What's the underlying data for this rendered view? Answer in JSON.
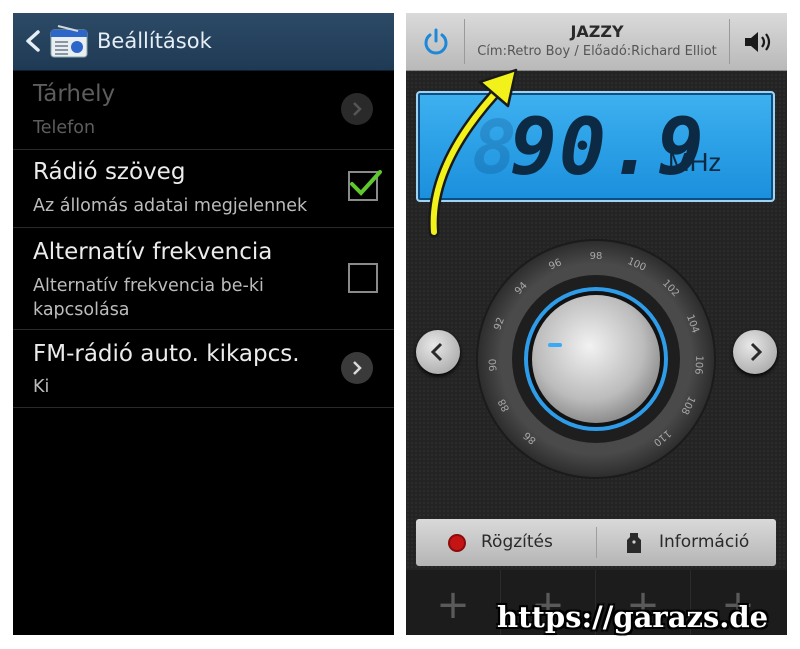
{
  "settings_screen": {
    "title": "Beállítások",
    "items": [
      {
        "title": "Tárhely",
        "subtitle": "Telefon",
        "control": "chevron",
        "enabled": false
      },
      {
        "title": "Rádió szöveg",
        "subtitle": "Az állomás adatai megjelennek",
        "control": "checkbox",
        "checked": true
      },
      {
        "title": "Alternatív frekvencia",
        "subtitle": "Alternatív frekvencia be-ki kapcsolása",
        "control": "checkbox",
        "checked": false
      },
      {
        "title": "FM-rádió auto. kikapcs.",
        "subtitle": "Ki",
        "control": "chevron",
        "enabled": true
      }
    ]
  },
  "radio_screen": {
    "station_name": "JAZZY",
    "track_info": "Cím:Retro Boy / Előadó:Richard Elliot",
    "frequency": "90.9",
    "frequency_ghost": "8",
    "unit": "MHz",
    "dial_ticks": [
      "86",
      "88",
      "90",
      "92",
      "94",
      "96",
      "98",
      "100",
      "102",
      "104",
      "106",
      "108",
      "110"
    ],
    "record_label": "Rögzítés",
    "info_label": "Információ",
    "presets": [
      "+",
      "+",
      "+",
      "+"
    ]
  },
  "colors": {
    "accent_blue": "#1a8fdc",
    "checkmark": "#5fc82e",
    "record": "#b01010"
  },
  "watermark": "https://garazs.de"
}
